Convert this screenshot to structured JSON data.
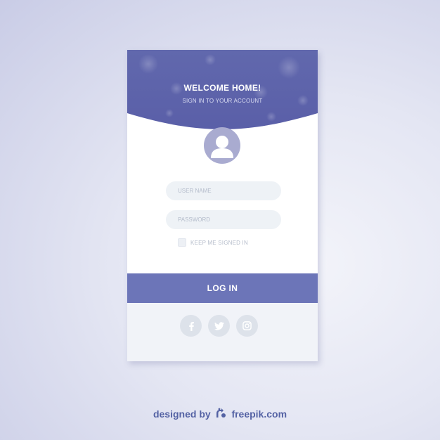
{
  "login_card": {
    "title": "WELCOME HOME!",
    "subtitle": "SIGN IN TO YOUR ACCOUNT",
    "username_placeholder": "USER NAME",
    "password_placeholder": "PASSWORD",
    "remember_label": "KEEP ME SIGNED IN",
    "remember_checked": false,
    "login_label": "LOG IN",
    "social_icons": [
      "facebook-icon",
      "twitter-icon",
      "instagram-icon"
    ]
  },
  "credit": {
    "prefix": "designed by",
    "brand": "freepik.com"
  },
  "colors": {
    "accent": "#6c75b8",
    "header_dark": "#5a60a8",
    "field_bg": "#eef2f6",
    "social_bg": "#dde2ea",
    "credit_text": "#5462a4"
  }
}
